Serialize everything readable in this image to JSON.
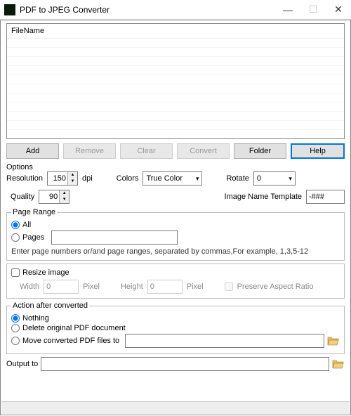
{
  "window": {
    "title": "PDF to JPEG Converter"
  },
  "filelist": {
    "header": "FileName"
  },
  "buttons": {
    "add": "Add",
    "remove": "Remove",
    "clear": "Clear",
    "convert": "Convert",
    "folder": "Folder",
    "help": "Help"
  },
  "options": {
    "section_label": "Options",
    "resolution_label": "Resolution",
    "resolution_value": "150",
    "dpi_label": "dpi",
    "colors_label": "Colors",
    "colors_value": "True Color",
    "rotate_label": "Rotate",
    "rotate_value": "0",
    "quality_label": "Quality",
    "quality_value": "90",
    "template_label": "Image Name Template",
    "template_value": "-###"
  },
  "pagerange": {
    "legend": "Page Range",
    "all_label": "All",
    "pages_label": "Pages",
    "pages_value": "",
    "hint": "Enter page numbers or/and page ranges, separated by commas,For example, 1,3,5-12"
  },
  "resize": {
    "check_label": "Resize image",
    "width_label": "Width",
    "width_value": "0",
    "height_label": "Height",
    "height_value": "0",
    "pixel_label": "Pixel",
    "preserve_label": "Preserve Aspect Ratio"
  },
  "action": {
    "legend": "Action after converted",
    "nothing_label": "Nothing",
    "delete_label": "Delete original PDF document",
    "move_label": "Move converted PDF files to",
    "move_path": ""
  },
  "output": {
    "label": "Output to",
    "value": ""
  }
}
